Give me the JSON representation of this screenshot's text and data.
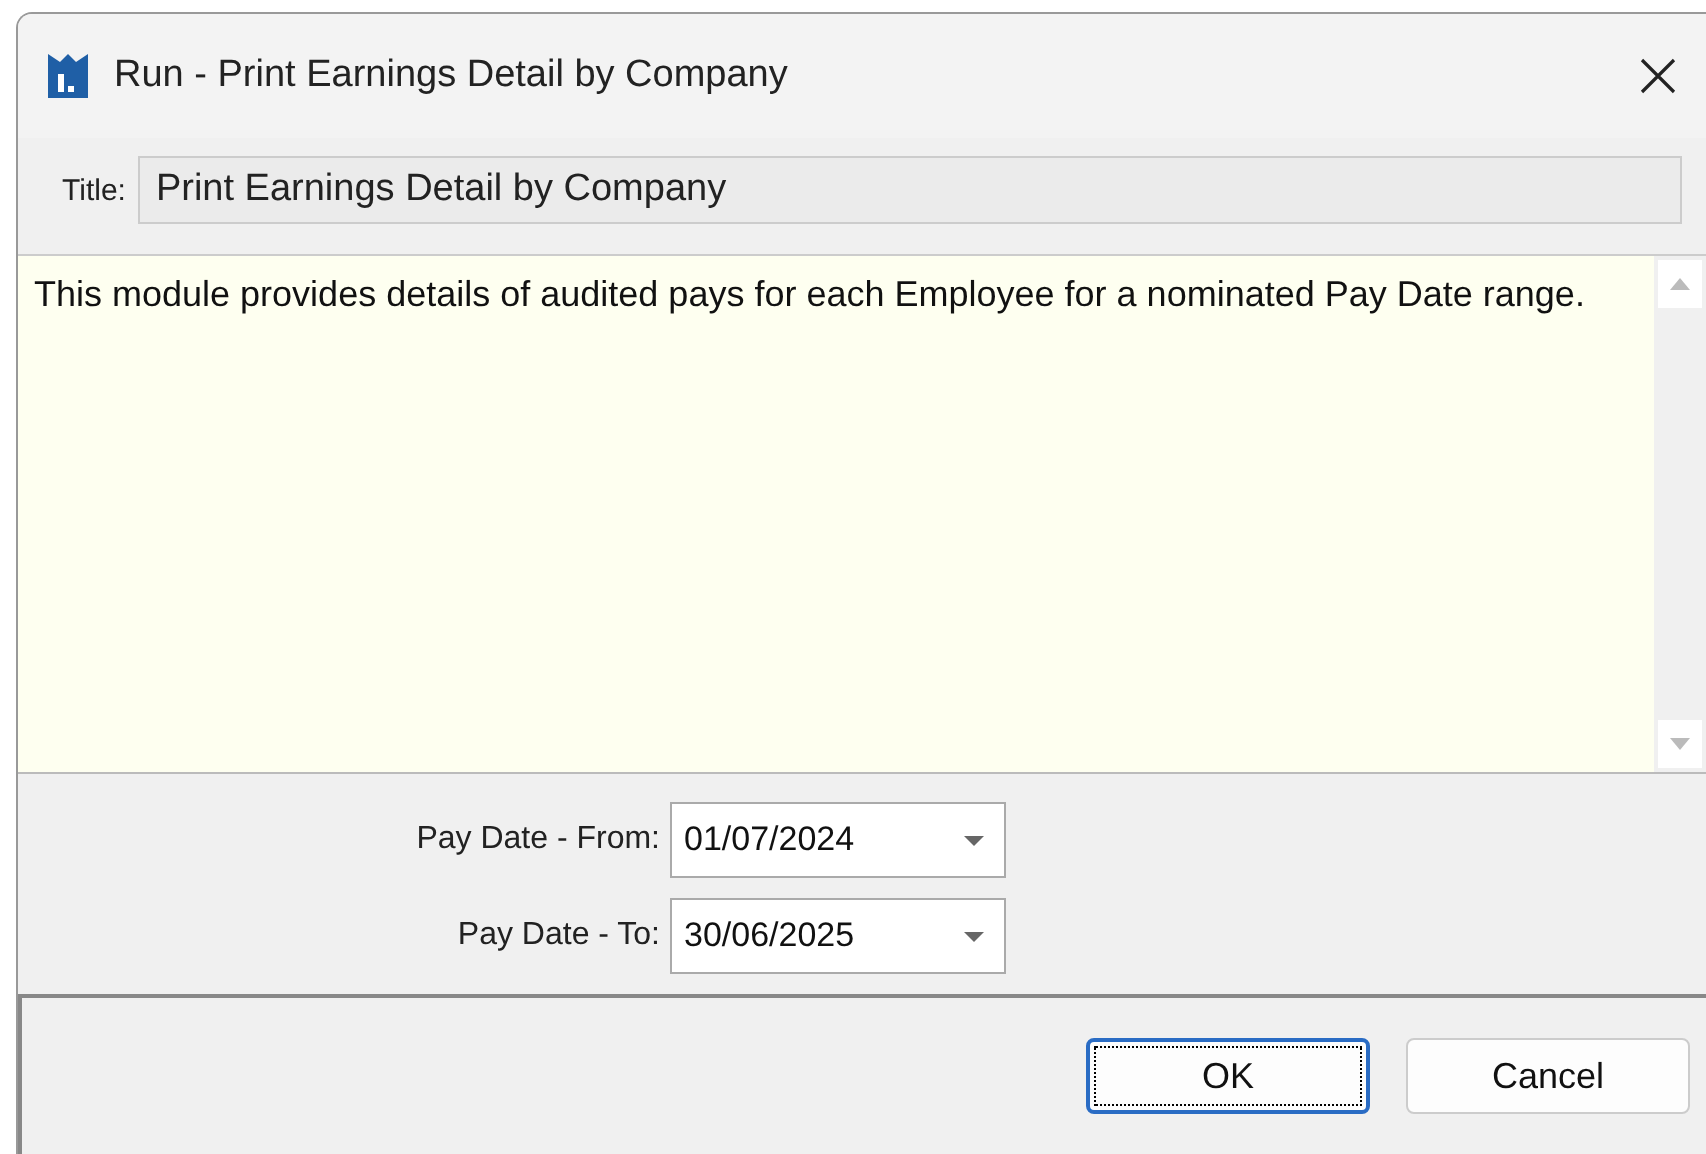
{
  "window": {
    "title": "Run - Print Earnings Detail by Company"
  },
  "title_field": {
    "label": "Title:",
    "value": "Print Earnings Detail by Company"
  },
  "description": "This module provides details of audited pays for each Employee for a nominated Pay Date range.",
  "date_fields": [
    {
      "label": "Pay Date - From:",
      "value": "01/07/2024"
    },
    {
      "label": "Pay Date - To:",
      "value": "30/06/2025"
    }
  ],
  "buttons": [
    {
      "label": "OK",
      "default": true
    },
    {
      "label": "Cancel",
      "default": false
    }
  ]
}
